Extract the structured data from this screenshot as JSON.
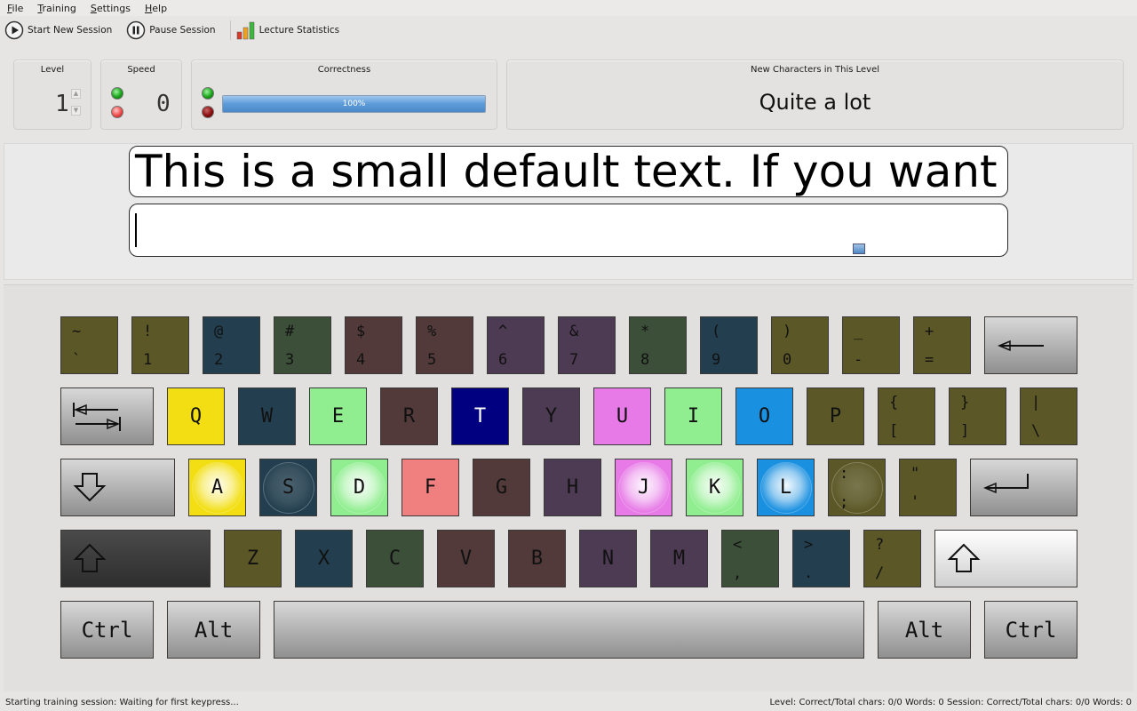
{
  "menu": [
    "File",
    "Training",
    "Settings",
    "Help"
  ],
  "toolbar": {
    "start": "Start New Session",
    "pause": "Pause Session",
    "stats": "Lecture Statistics"
  },
  "panels": {
    "level": {
      "title": "Level",
      "value": "1"
    },
    "speed": {
      "title": "Speed",
      "value": "0"
    },
    "correctness": {
      "title": "Correctness",
      "percent": 100,
      "label": "100%"
    },
    "new_chars": {
      "title": "New Characters in This Level",
      "value": "Quite a lot"
    }
  },
  "training_text": "This is a small default text. If you want",
  "input_text": "",
  "keyboard": {
    "row1": [
      {
        "top": "~",
        "bot": "`",
        "color": "#5b5726"
      },
      {
        "top": "!",
        "bot": "1",
        "color": "#5b5726"
      },
      {
        "top": "@",
        "bot": "2",
        "color": "#233f4f"
      },
      {
        "top": "#",
        "bot": "3",
        "color": "#3c5039"
      },
      {
        "top": "$",
        "bot": "4",
        "color": "#523a3a"
      },
      {
        "top": "%",
        "bot": "5",
        "color": "#523a3a"
      },
      {
        "top": "^",
        "bot": "6",
        "color": "#4d3a53"
      },
      {
        "top": "&",
        "bot": "7",
        "color": "#4d3a53"
      },
      {
        "top": "*",
        "bot": "8",
        "color": "#3c5039"
      },
      {
        "top": "(",
        "bot": "9",
        "color": "#233f4f"
      },
      {
        "top": ")",
        "bot": "0",
        "color": "#5b5726"
      },
      {
        "top": "_",
        "bot": "-",
        "color": "#5b5726"
      },
      {
        "top": "+",
        "bot": "=",
        "color": "#5b5726"
      }
    ],
    "row2": [
      {
        "label": "Q",
        "color": "#f2de12"
      },
      {
        "label": "W",
        "color": "#233f4f"
      },
      {
        "label": "E",
        "color": "#90ee90"
      },
      {
        "label": "R",
        "color": "#523a3a"
      },
      {
        "label": "T",
        "color": "#000080",
        "text": "#ffffff"
      },
      {
        "label": "Y",
        "color": "#4d3a53"
      },
      {
        "label": "U",
        "color": "#e77ae7"
      },
      {
        "label": "I",
        "color": "#90ee90"
      },
      {
        "label": "O",
        "color": "#1a90e0"
      },
      {
        "label": "P",
        "color": "#5b5726"
      },
      {
        "top": "{",
        "bot": "[",
        "color": "#5b5726"
      },
      {
        "top": "}",
        "bot": "]",
        "color": "#5b5726"
      },
      {
        "top": "|",
        "bot": "\\",
        "color": "#5b5726"
      }
    ],
    "row3": [
      {
        "label": "A",
        "color": "#f2de12",
        "home": true
      },
      {
        "label": "S",
        "color": "#233f4f",
        "home": true
      },
      {
        "label": "D",
        "color": "#90ee90",
        "home": true
      },
      {
        "label": "F",
        "color": "#f08080"
      },
      {
        "label": "G",
        "color": "#523a3a"
      },
      {
        "label": "H",
        "color": "#4d3a53"
      },
      {
        "label": "J",
        "color": "#e77ae7",
        "home": true
      },
      {
        "label": "K",
        "color": "#90ee90",
        "home": true
      },
      {
        "label": "L",
        "color": "#1a90e0",
        "home": true
      },
      {
        "top": ":",
        "bot": ";",
        "color": "#5b5726",
        "home": true
      },
      {
        "top": "\"",
        "bot": "'",
        "color": "#5b5726"
      }
    ],
    "row4": [
      {
        "label": "Z",
        "color": "#5b5726"
      },
      {
        "label": "X",
        "color": "#233f4f"
      },
      {
        "label": "C",
        "color": "#3c5039"
      },
      {
        "label": "V",
        "color": "#523a3a"
      },
      {
        "label": "B",
        "color": "#523a3a"
      },
      {
        "label": "N",
        "color": "#4d3a53"
      },
      {
        "label": "M",
        "color": "#4d3a53"
      },
      {
        "top": "<",
        "bot": ",",
        "color": "#3c5039"
      },
      {
        "top": ">",
        "bot": ".",
        "color": "#233f4f"
      },
      {
        "top": "?",
        "bot": "/",
        "color": "#5b5726"
      }
    ],
    "row5": {
      "left_ctrl": "Ctrl",
      "left_alt": "Alt",
      "right_alt": "Alt",
      "right_ctrl": "Ctrl"
    }
  },
  "status": {
    "left": "Starting training session: Waiting for first keypress...",
    "right": "Level:  Correct/Total chars: 0/0  Words: 0  Session: Correct/Total chars: 0/0  Words: 0"
  }
}
